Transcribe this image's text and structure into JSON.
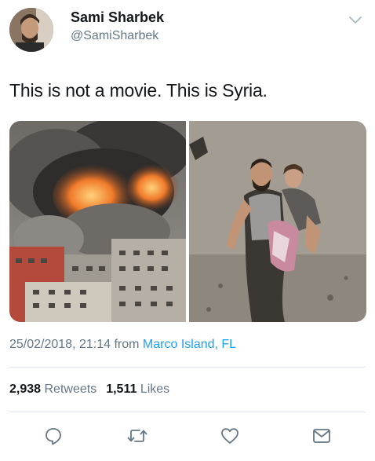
{
  "tweet": {
    "author_name": "Sami Sharbek",
    "author_handle": "@SamiSharbek",
    "text": "This is not a movie. This is Syria.",
    "timestamp": "25/02/2018, 21:14",
    "from_label": "from",
    "location": "Marco Island, FL",
    "retweets_count": "2,938",
    "retweets_label": "Retweets",
    "likes_count": "1,511",
    "likes_label": "Likes"
  },
  "icons": {
    "menu": "chevron-down-icon",
    "reply": "reply-icon",
    "retweet": "retweet-icon",
    "like": "heart-icon",
    "dm": "envelope-icon"
  },
  "colors": {
    "text": "#14171a",
    "secondary": "#657786",
    "link": "#1da1f2",
    "divider": "#e1e8ed"
  }
}
